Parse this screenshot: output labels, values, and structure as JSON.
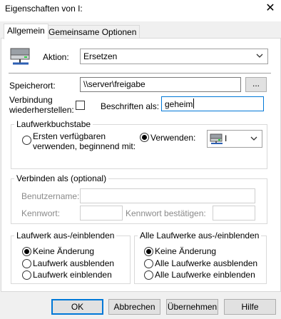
{
  "window": {
    "title": "Eigenschaften von I:",
    "close_glyph": "✕"
  },
  "tabs": [
    {
      "label": "Allgemein",
      "active": true
    },
    {
      "label": "Gemeinsame Optionen",
      "active": false
    }
  ],
  "general": {
    "action_label": "Aktion:",
    "action_value": "Ersetzen",
    "location_label": "Speicherort:",
    "location_value": "\\\\server\\freigabe",
    "browse_label": "...",
    "reconnect_label_line1": "Verbindung",
    "reconnect_label_line2": "wiederherstellen:",
    "reconnect_checked": false,
    "label_as_label": "Beschriften als:",
    "label_as_value": "geheim"
  },
  "drive_letter": {
    "legend": "Laufwerkbuchstabe",
    "first_available_line1": "Ersten verfügbaren",
    "first_available_line2": "verwenden, beginnend mit:",
    "use_label": "Verwenden:",
    "use_value": "I",
    "selected": "use"
  },
  "connect_as": {
    "legend": "Verbinden als (optional)",
    "username_label": "Benutzername:",
    "password_label": "Kennwort:",
    "confirm_password_label": "Kennwort bestätigen:"
  },
  "show_hide_drive": {
    "legend": "Laufwerk aus-/einblenden",
    "options": [
      "Keine Änderung",
      "Laufwerk ausblenden",
      "Laufwerk einblenden"
    ],
    "selected_index": 0
  },
  "show_hide_all": {
    "legend": "Alle Laufwerke aus-/einblenden",
    "options": [
      "Keine Änderung",
      "Alle Laufwerke ausblenden",
      "Alle Laufwerke einblenden"
    ],
    "selected_index": 0
  },
  "buttons": {
    "ok": "OK",
    "cancel": "Abbrechen",
    "apply": "Übernehmen",
    "help": "Hilfe"
  },
  "icons": {
    "action_icon": "network-drive-icon",
    "drive_icon": "network-drive-icon"
  },
  "colors": {
    "focus_border": "#0078d7",
    "window_bg": "#f0f0f0",
    "panel_bg": "#ffffff"
  }
}
